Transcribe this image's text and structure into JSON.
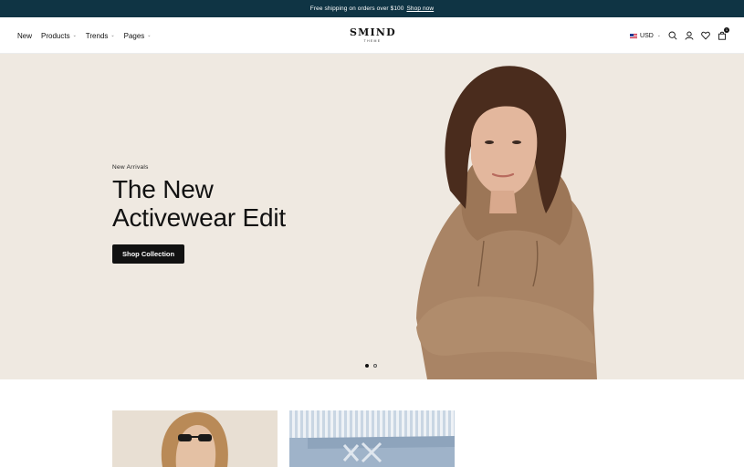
{
  "announcement": {
    "text": "Free shipping on orders over $100",
    "link": "Shop now"
  },
  "nav": {
    "items": [
      {
        "label": "New",
        "has_dropdown": false
      },
      {
        "label": "Products",
        "has_dropdown": true
      },
      {
        "label": "Trends",
        "has_dropdown": true
      },
      {
        "label": "Pages",
        "has_dropdown": true
      }
    ]
  },
  "logo": {
    "main": "SMIND",
    "sub": "THEME"
  },
  "tools": {
    "currency": "USD",
    "cart_count": "1",
    "icons": [
      "search-icon",
      "user-icon",
      "heart-icon",
      "bag-icon"
    ]
  },
  "hero": {
    "eyebrow": "New Arrivals",
    "headline_line1": "The New",
    "headline_line2": "Activewear Edit",
    "cta": "Shop Collection",
    "slide_count": 2,
    "active_slide": 1
  },
  "colors": {
    "announcement_bg": "#0f3444",
    "hero_bg": "#efe9e1",
    "button_bg": "#111111"
  }
}
